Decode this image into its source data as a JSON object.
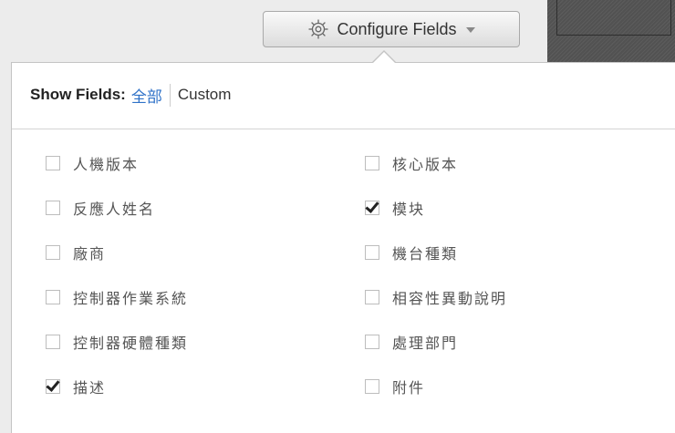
{
  "toolbar": {
    "configure_label": "Configure Fields",
    "gear_icon": "gear-icon",
    "caret_icon": "chevron-down-icon"
  },
  "popover": {
    "show_fields_label": "Show Fields:",
    "options": [
      "全部",
      "Custom"
    ],
    "selected_option": "全部",
    "accent_color": "#2f72c8",
    "left_fields": [
      {
        "label": "人機版本",
        "checked": false
      },
      {
        "label": "反應人姓名",
        "checked": false
      },
      {
        "label": "廠商",
        "checked": false
      },
      {
        "label": "控制器作業系統",
        "checked": false
      },
      {
        "label": "控制器硬體種類",
        "checked": false
      },
      {
        "label": "描述",
        "checked": true
      }
    ],
    "right_fields": [
      {
        "label": "核心版本",
        "checked": false
      },
      {
        "label": "模块",
        "checked": true
      },
      {
        "label": "機台種類",
        "checked": false
      },
      {
        "label": "相容性異動說明",
        "checked": false
      },
      {
        "label": "處理部門",
        "checked": false
      },
      {
        "label": "附件",
        "checked": false
      }
    ]
  }
}
